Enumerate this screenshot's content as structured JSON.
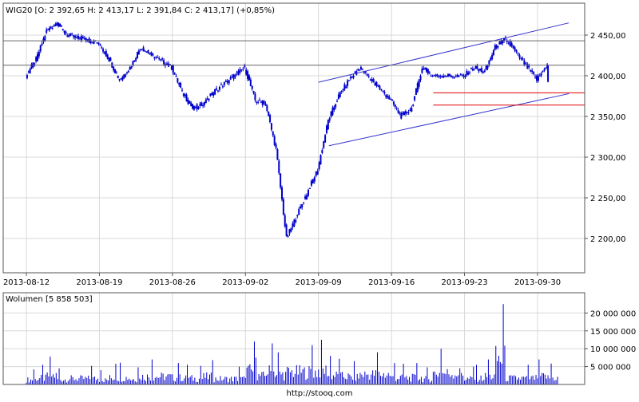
{
  "header": {
    "title": "WIG20 [O: 2 392,65  H: 2 413,17  L: 2 391,84  C: 2 413,17]  (+0,85%)"
  },
  "footer": {
    "url": "http://stooq.com"
  },
  "colors": {
    "price": "#0000cc",
    "volume": "#0000cc",
    "channel": "#3333cc",
    "support": "#dd0000",
    "horizontal": "#666666",
    "grid": "#d8d8d8",
    "frame": "#555555"
  },
  "chart_data": [
    {
      "type": "candlestick",
      "title": "WIG20 [O: 2 392,65  H: 2 413,17  L: 2 391,84  C: 2 413,17]  (+0,85%)",
      "x_tick_labels": [
        "2013-08-12",
        "2013-08-19",
        "2013-08-26",
        "2013-09-02",
        "2013-09-09",
        "2013-09-16",
        "2013-09-23",
        "2013-09-30"
      ],
      "y_tick_labels": [
        "2 200,00",
        "2 250,00",
        "2 300,00",
        "2 350,00",
        "2 400,00",
        "2 450,00"
      ],
      "y_ticks": [
        2200,
        2250,
        2300,
        2350,
        2400,
        2450
      ],
      "ylim": [
        2165,
        2480
      ],
      "grid": true,
      "last": {
        "open": 2392.65,
        "high": 2413.17,
        "low": 2391.84,
        "close": 2413.17,
        "change_pct": 0.85
      },
      "series": [
        {
          "x": [
            "2013-08-12",
            "2013-08-13",
            "2013-08-14",
            "2013-08-15",
            "2013-08-16",
            "2013-08-19",
            "2013-08-20",
            "2013-08-21",
            "2013-08-22",
            "2013-08-23",
            "2013-08-26",
            "2013-08-27",
            "2013-08-28",
            "2013-08-29",
            "2013-08-30",
            "2013-09-02",
            "2013-09-03",
            "2013-09-04",
            "2013-09-05",
            "2013-09-06",
            "2013-09-09",
            "2013-09-10",
            "2013-09-11",
            "2013-09-12",
            "2013-09-13",
            "2013-09-16",
            "2013-09-17",
            "2013-09-18",
            "2013-09-19",
            "2013-09-20",
            "2013-09-23",
            "2013-09-24",
            "2013-09-25",
            "2013-09-26",
            "2013-09-27",
            "2013-09-30",
            "2013-10-01"
          ],
          "close": [
            2400,
            2420,
            2455,
            2465,
            2450,
            2440,
            2420,
            2395,
            2410,
            2435,
            2410,
            2380,
            2360,
            2365,
            2380,
            2410,
            2370,
            2365,
            2310,
            2200,
            2285,
            2345,
            2375,
            2395,
            2410,
            2370,
            2350,
            2360,
            2410,
            2400,
            2400,
            2410,
            2405,
            2435,
            2445,
            2395,
            2413.17
          ]
        }
      ],
      "annotations": {
        "upper_channel": {
          "start": [
            "2013-09-09",
            2392
          ],
          "end": [
            "2013-10-03",
            2465
          ]
        },
        "lower_channel": {
          "start": [
            "2013-09-10",
            2314
          ],
          "end": [
            "2013-10-03",
            2378
          ]
        },
        "support_lines": [
          {
            "y": 2379,
            "from": "2013-09-20"
          },
          {
            "y": 2364,
            "from": "2013-09-20"
          }
        ],
        "horizontal_lines": [
          {
            "y": 2443
          },
          {
            "y": 2413
          }
        ]
      }
    },
    {
      "type": "bar",
      "title": "Wolumen [5 858 503]",
      "y_tick_labels": [
        "5 000 000",
        "10 000 000",
        "15 000 000",
        "20 000 000"
      ],
      "y_ticks": [
        5000000,
        10000000,
        15000000,
        20000000
      ],
      "ylim": [
        0,
        25000000
      ],
      "grid": true,
      "last_volume": 5858503,
      "series": [
        {
          "x": [
            "2013-08-12",
            "2013-08-13",
            "2013-08-14",
            "2013-08-15",
            "2013-08-16",
            "2013-08-19",
            "2013-08-20",
            "2013-08-21",
            "2013-08-22",
            "2013-08-23",
            "2013-08-26",
            "2013-08-27",
            "2013-08-28",
            "2013-08-29",
            "2013-08-30",
            "2013-09-02",
            "2013-09-03",
            "2013-09-04",
            "2013-09-05",
            "2013-09-06",
            "2013-09-09",
            "2013-09-10",
            "2013-09-11",
            "2013-09-12",
            "2013-09-13",
            "2013-09-16",
            "2013-09-17",
            "2013-09-18",
            "2013-09-19",
            "2013-09-20",
            "2013-09-23",
            "2013-09-24",
            "2013-09-25",
            "2013-09-26",
            "2013-09-27",
            "2013-09-30",
            "2013-10-01"
          ],
          "peak_volume": [
            4200000,
            5500000,
            7800000,
            4500000,
            5200000,
            4000000,
            5800000,
            6100000,
            4800000,
            7000000,
            6000000,
            5500000,
            5200000,
            6800000,
            5000000,
            12000000,
            7500000,
            11500000,
            9000000,
            11000000,
            12500000,
            8000000,
            7200000,
            6500000,
            9000000,
            6000000,
            5800000,
            6000000,
            4800000,
            10000000,
            5000000,
            5500000,
            7000000,
            22500000,
            5500000,
            7000000,
            5858503
          ]
        }
      ]
    }
  ]
}
